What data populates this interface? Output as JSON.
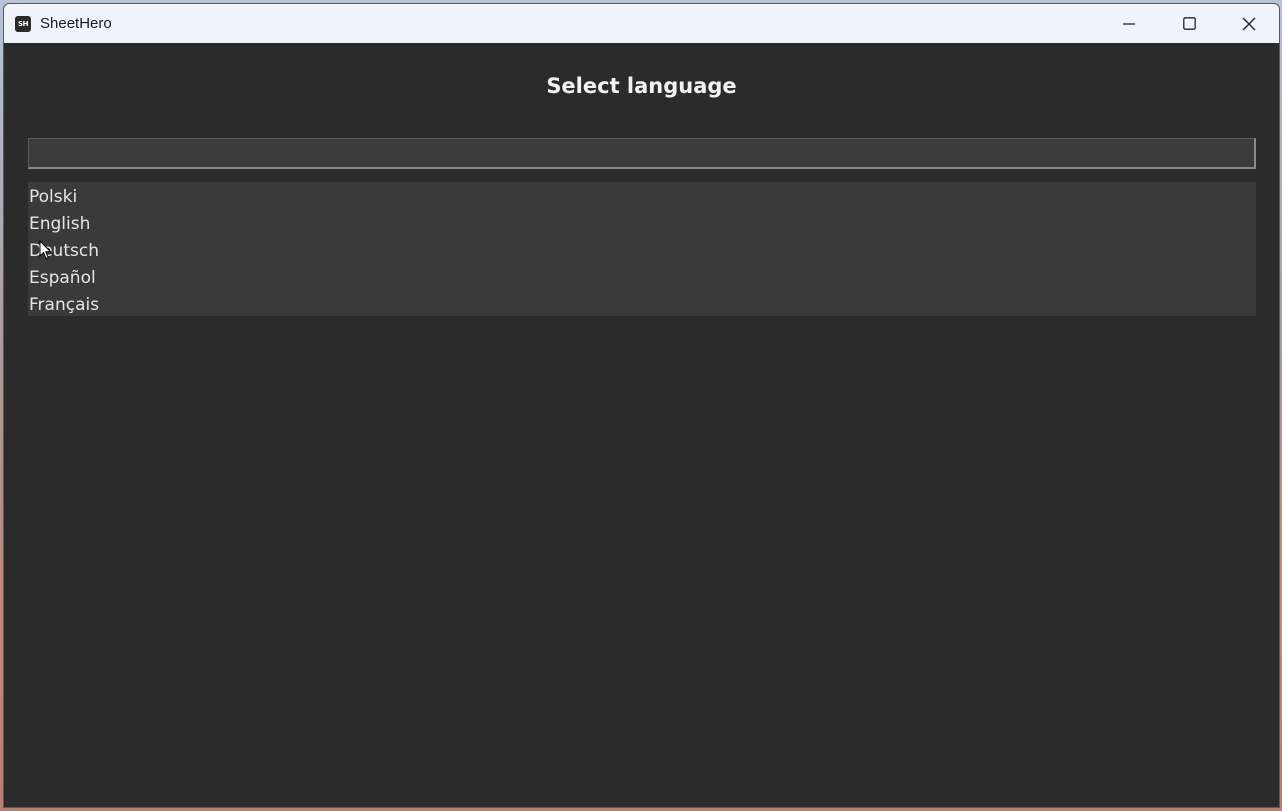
{
  "window": {
    "title": "SheetHero",
    "icon_text": "SH"
  },
  "main": {
    "heading": "Select language",
    "search": {
      "value": "",
      "placeholder": ""
    },
    "languages": [
      {
        "label": "Polski"
      },
      {
        "label": "English"
      },
      {
        "label": "Deutsch"
      },
      {
        "label": "Español"
      },
      {
        "label": "Français"
      }
    ]
  },
  "colors": {
    "background": "#2b2b2b",
    "list_background": "#3a3a3a",
    "titlebar": "#f0f3f9",
    "text": "#e6e6e6"
  }
}
